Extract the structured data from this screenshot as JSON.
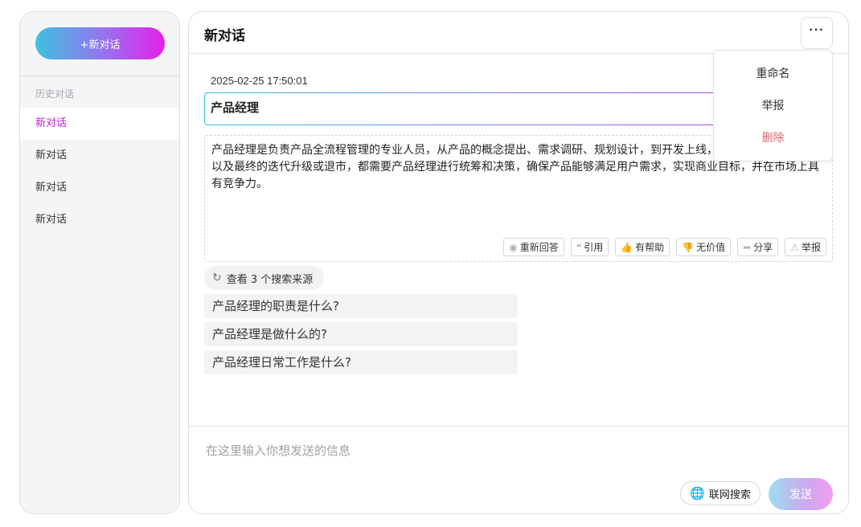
{
  "sidebar": {
    "new_chat_label": "+新对话",
    "history_title": "历史对话",
    "items": [
      {
        "label": "新对话",
        "active": true
      },
      {
        "label": "新对话",
        "active": false
      },
      {
        "label": "新对话",
        "active": false
      },
      {
        "label": "新对话",
        "active": false
      }
    ]
  },
  "header": {
    "title": "新对话",
    "more_label": "···"
  },
  "conversation": {
    "timestamp": "2025-02-25 17:50:01",
    "question": "产品经理",
    "answer": "产品经理是负责产品全流程管理的专业人员，从产品的概念提出、需求调研、规划设计，到开发上线，再到后续的运营优化以及最终的迭代升级或退市，都需要产品经理进行统筹和决策，确保产品能够满足用户需求，实现商业目标，并在市场上具有竞争力。",
    "actions": [
      {
        "icon": "◉",
        "label": "重新回答",
        "name": "regenerate"
      },
      {
        "icon": "❝",
        "label": "引用",
        "name": "quote"
      },
      {
        "icon": "👍",
        "label": "有帮助",
        "name": "helpful"
      },
      {
        "icon": "👎",
        "label": "无价值",
        "name": "not-helpful"
      },
      {
        "icon": "➦",
        "label": "分享",
        "name": "share"
      },
      {
        "icon": "⚠",
        "label": "举报",
        "name": "report"
      }
    ],
    "sources_label": "查看 3 个搜索来源",
    "suggestions": [
      "产品经理的职责是什么?",
      "产品经理是做什么的?",
      "产品经理日常工作是什么?"
    ]
  },
  "composer": {
    "placeholder": "在这里输入你想发送的信息",
    "web_search_label": "联网搜索",
    "send_label": "发送"
  },
  "menu": {
    "items": [
      {
        "label": "重命名",
        "danger": false
      },
      {
        "label": "举报",
        "danger": false
      },
      {
        "label": "删除",
        "danger": true
      }
    ]
  },
  "colors": {
    "accent": "#c21ed9",
    "danger": "#e0646e",
    "gradient_start": "#3fc0e0",
    "gradient_end": "#e620e8"
  }
}
